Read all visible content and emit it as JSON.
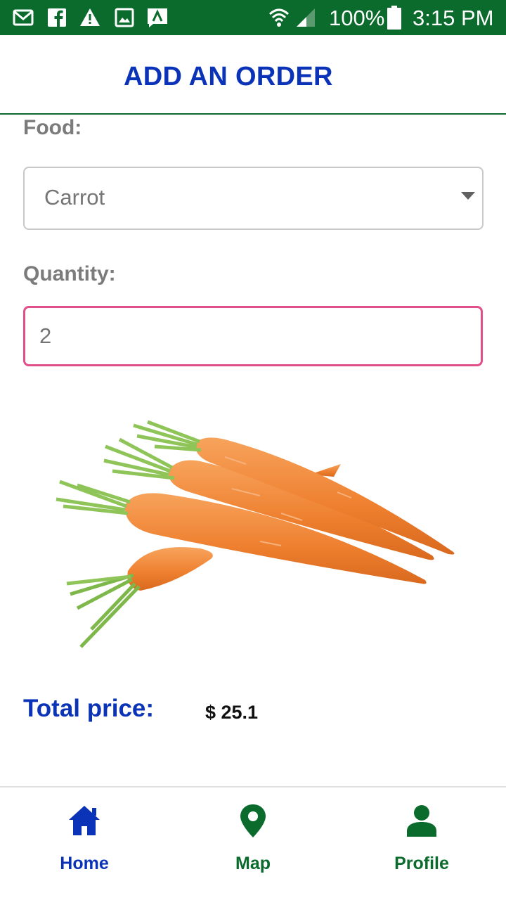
{
  "status_bar": {
    "battery": "100%",
    "time": "3:15 PM",
    "icons": [
      "gmail-icon",
      "facebook-icon",
      "warning-icon",
      "image-icon",
      "app-notification-icon",
      "wifi-icon",
      "signal-icon",
      "battery-icon"
    ]
  },
  "header": {
    "title": "ADD AN ORDER"
  },
  "form": {
    "food_label": "Food:",
    "food_value": "Carrot",
    "quantity_label": "Quantity:",
    "quantity_value": "2"
  },
  "product": {
    "image": "carrot-image"
  },
  "total": {
    "label": "Total price:",
    "value": "$ 25.1"
  },
  "nav": {
    "items": [
      {
        "label": "Home",
        "icon": "home-icon",
        "active": true
      },
      {
        "label": "Map",
        "icon": "map-pin-icon",
        "active": false
      },
      {
        "label": "Profile",
        "icon": "person-icon",
        "active": false
      }
    ]
  },
  "colors": {
    "primary_green": "#0a6b2c",
    "accent_blue": "#0b33b8",
    "input_focus": "#e14f8a",
    "carrot_orange": "#f08a3c"
  }
}
